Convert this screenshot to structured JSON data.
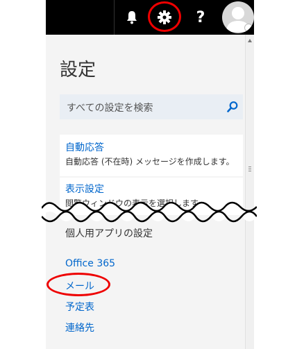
{
  "header": {
    "help_glyph": "?",
    "icons": [
      "bell-icon",
      "gear-icon",
      "help-icon",
      "avatar-icon"
    ]
  },
  "settings": {
    "title": "設定",
    "search": {
      "placeholder": "すべての設定を検索"
    },
    "items": [
      {
        "label": "自動応答",
        "description": "自動応答 (不在時) メッセージを作成します。"
      },
      {
        "label": "表示設定",
        "description": "閲覧ウィンドウの表示を選択します。"
      }
    ],
    "section_title": "個人用アプリの設定",
    "links": [
      "Office 365",
      "メール",
      "予定表",
      "連絡先"
    ]
  },
  "colors": {
    "accent": "#0066cc",
    "highlight": "#e00000",
    "header_bg": "#000000"
  }
}
